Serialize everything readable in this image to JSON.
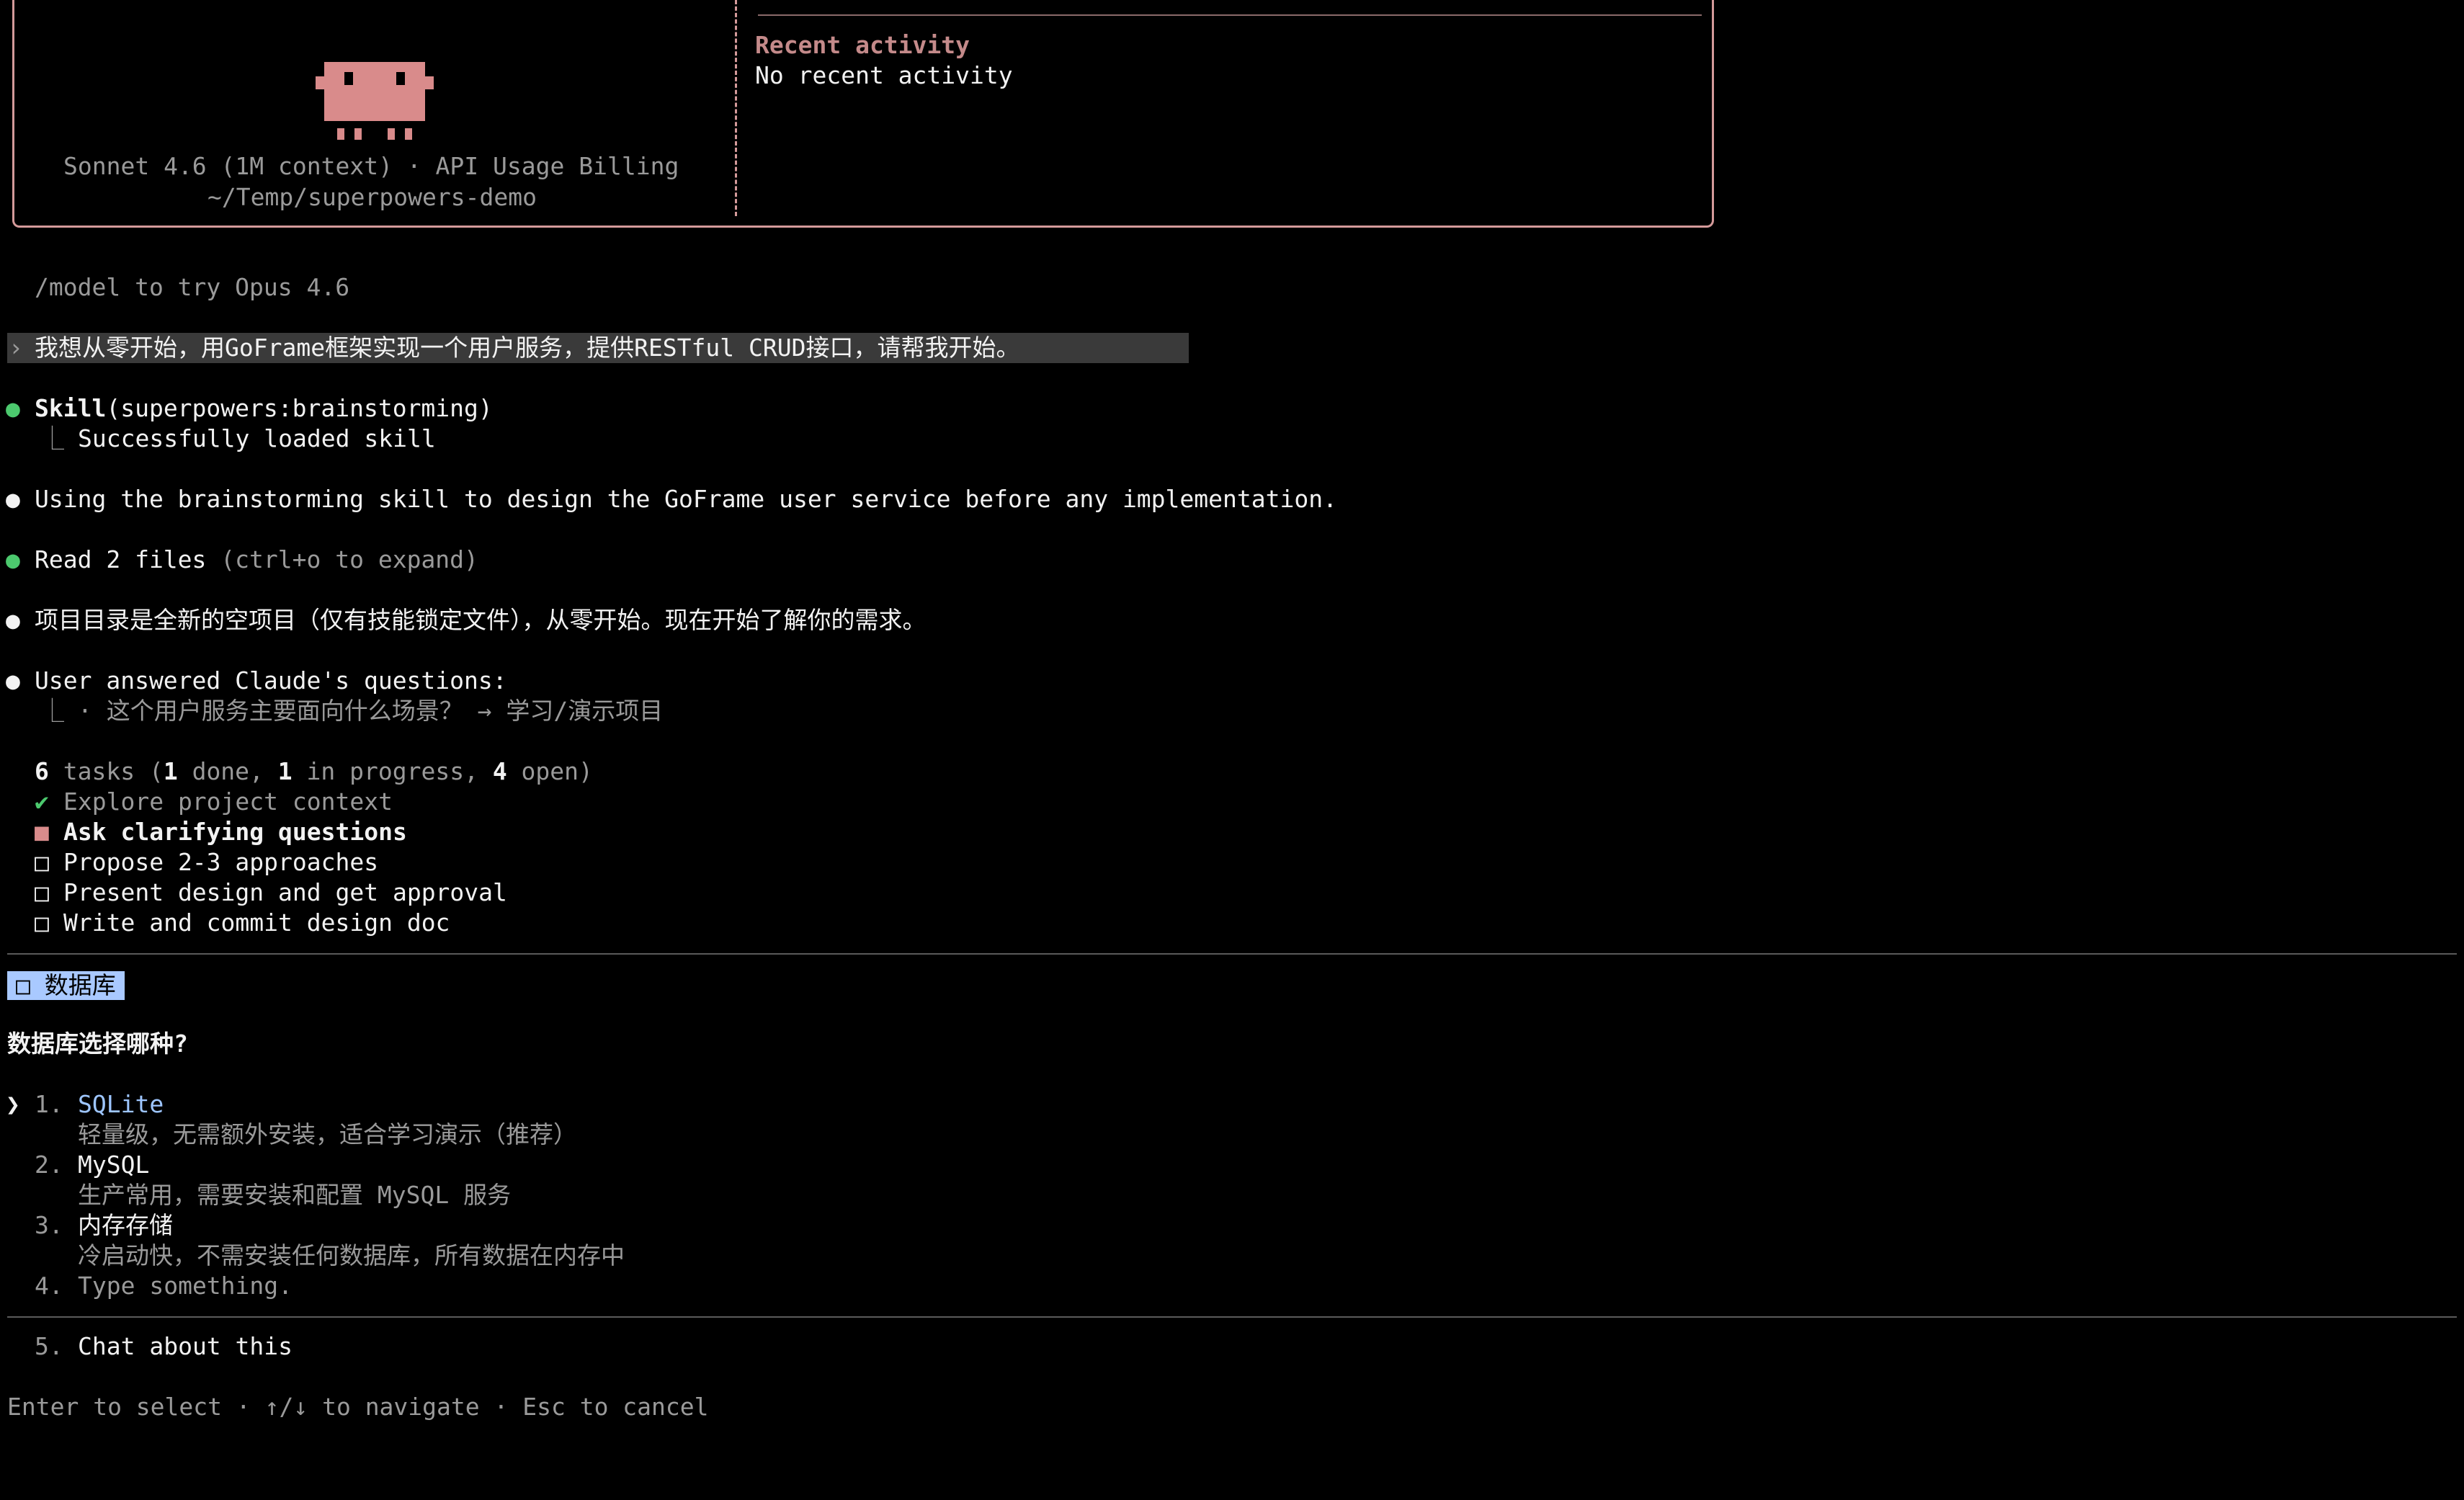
{
  "header": {
    "model_line": "Sonnet 4.6 (1M context) · API Usage Billing",
    "cwd": "~/Temp/superpowers-demo",
    "recent_activity_title": "Recent activity",
    "recent_activity_text": "No recent activity"
  },
  "tip": "/model to try Opus 4.6",
  "user_prompt": "我想从零开始，用GoFrame框架实现一个用户服务，提供RESTful CRUD接口，请帮我开始。",
  "log": {
    "skill_name": "Skill",
    "skill_arg": "(superpowers:brainstorming)",
    "skill_result": "Successfully loaded skill",
    "using_line": "Using the brainstorming skill to design the GoFrame user service before any implementation.",
    "read_files": "Read 2 files",
    "read_hint": "(ctrl+o to expand)",
    "project_note": "项目目录是全新的空项目（仅有技能锁定文件），从零开始。现在开始了解你的需求。",
    "answered": "User answered Claude's questions:",
    "answer_detail": "· 这个用户服务主要面向什么场景？ → 学习/演示项目"
  },
  "tasks": {
    "summary_count": "6",
    "summary_text": " tasks (",
    "done": "1",
    "done_label": " done, ",
    "in_progress": "1",
    "in_progress_label": " in progress, ",
    "open": "4",
    "open_label": " open)",
    "items": [
      {
        "mark": "✔",
        "label": "Explore project context",
        "state": "done"
      },
      {
        "mark": "■",
        "label": "Ask clarifying questions",
        "state": "in_progress"
      },
      {
        "mark": "□",
        "label": "Propose 2-3 approaches",
        "state": "open"
      },
      {
        "mark": "□",
        "label": "Present design and get approval",
        "state": "open"
      },
      {
        "mark": "□",
        "label": "Write and commit design doc",
        "state": "open"
      }
    ]
  },
  "question": {
    "tab_label": "□ 数据库",
    "title": "数据库选择哪种?",
    "cursor": "❯",
    "options": [
      {
        "num": "1.",
        "label": "SQLite",
        "desc": "轻量级，无需额外安装，适合学习演示（推荐）"
      },
      {
        "num": "2.",
        "label": "MySQL",
        "desc": "生产常用，需要安装和配置 MySQL 服务"
      },
      {
        "num": "3.",
        "label": "内存存储",
        "desc": "冷启动快，不需安装任何数据库，所有数据在内存中"
      },
      {
        "num": "4.",
        "label": "Type something.",
        "desc": ""
      }
    ],
    "chat_option": {
      "num": "5.",
      "label": "Chat about this"
    },
    "footer": "Enter to select · ↑/↓ to navigate · Esc to cancel"
  },
  "colors": {
    "accent_border": "#d49a9a",
    "selected_option": "#9ec6ff",
    "tab_bg": "#a9c9ff",
    "bullet_green": "#4cc96e"
  }
}
